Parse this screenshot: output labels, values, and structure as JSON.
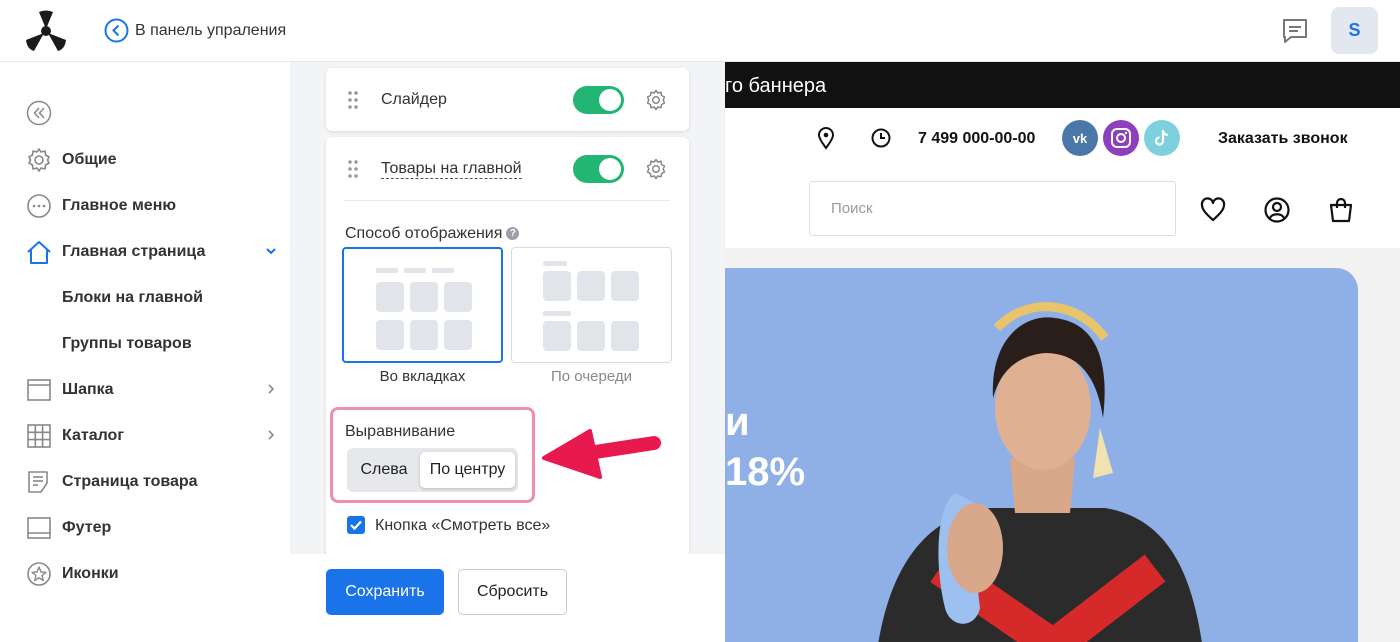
{
  "topbar": {
    "back_label": "В панель упраления",
    "avatar_letter": "S"
  },
  "sidebar": {
    "items": [
      {
        "label": "Общие",
        "icon": "gear-icon"
      },
      {
        "label": "Главное меню",
        "icon": "dots-circle-icon"
      },
      {
        "label": "Главная страница",
        "icon": "home-icon",
        "expanded": true
      },
      {
        "label": "Шапка",
        "icon": "header-layout-icon"
      },
      {
        "label": "Каталог",
        "icon": "grid-icon"
      },
      {
        "label": "Страница товара",
        "icon": "product-page-icon"
      },
      {
        "label": "Футер",
        "icon": "footer-layout-icon"
      },
      {
        "label": "Иконки",
        "icon": "star-icon"
      }
    ],
    "subitems": [
      {
        "label": "Блоки на главной"
      },
      {
        "label": "Группы товаров"
      }
    ]
  },
  "editor": {
    "block1": {
      "title": "Слайдер",
      "enabled": true
    },
    "block2": {
      "title": "Товары на главной",
      "enabled": true
    },
    "display_label": "Способ отображения",
    "display_options": [
      {
        "label": "Во вкладках",
        "selected": true
      },
      {
        "label": "По очереди",
        "selected": false
      }
    ],
    "align_label": "Выравнивание",
    "align_options": [
      {
        "label": "Слева",
        "active": false
      },
      {
        "label": "По центру",
        "active": true
      }
    ],
    "show_all_label": "Кнопка «Смотреть все»",
    "show_all_checked": true,
    "save_label": "Сохранить",
    "reset_label": "Сбросить"
  },
  "preview": {
    "banner_text": "го баннера",
    "phone": "7 499 000-00-00",
    "callback": "Заказать звонок",
    "search_placeholder": "Поиск",
    "hero_line1": "и",
    "hero_line2": "18%",
    "socials": [
      "vk",
      "instagram",
      "tiktok"
    ]
  },
  "colors": {
    "accent": "#1a73e8",
    "toggle_on": "#22b573",
    "highlight": "#ec8fb1",
    "arrow": "#e8194f"
  }
}
